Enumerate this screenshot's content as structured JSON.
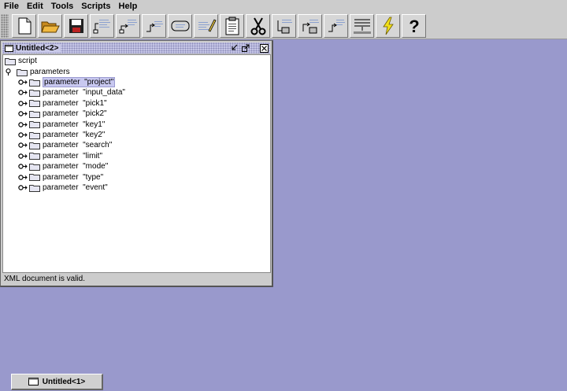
{
  "menu": [
    "File",
    "Edit",
    "Tools",
    "Scripts",
    "Help"
  ],
  "toolbar": {
    "buttons": [
      "new-document-icon",
      "open-folder-icon",
      "save-disk-icon",
      "script-step-1-icon",
      "script-step-2-icon",
      "script-step-3-icon",
      "loop-icon",
      "edit-pencil-icon",
      "clipboard-icon",
      "scissors-icon",
      "script-branch-1-icon",
      "script-branch-2-icon",
      "script-branch-3-icon",
      "build-grid-icon",
      "lightning-icon",
      "help-question-icon"
    ]
  },
  "window": {
    "title": "Untitled<2>",
    "status": "XML document is valid.",
    "tree": {
      "root": "script",
      "group": "parameters",
      "items": [
        "parameter  \"project\"",
        "parameter  \"input_data\"",
        "parameter  \"pick1\"",
        "parameter  \"pick2\"",
        "parameter  \"key1\"",
        "parameter  \"key2\"",
        "parameter  \"search\"",
        "parameter  \"limit\"",
        "parameter  \"mode\"",
        "parameter  \"type\"",
        "parameter  \"event\""
      ],
      "selected_index": 0
    }
  },
  "taskbar": {
    "label": "Untitled<1>"
  },
  "colors": {
    "desktop": "#9999cc",
    "selection": "#c8c8f0",
    "chrome": "#cccccc"
  }
}
